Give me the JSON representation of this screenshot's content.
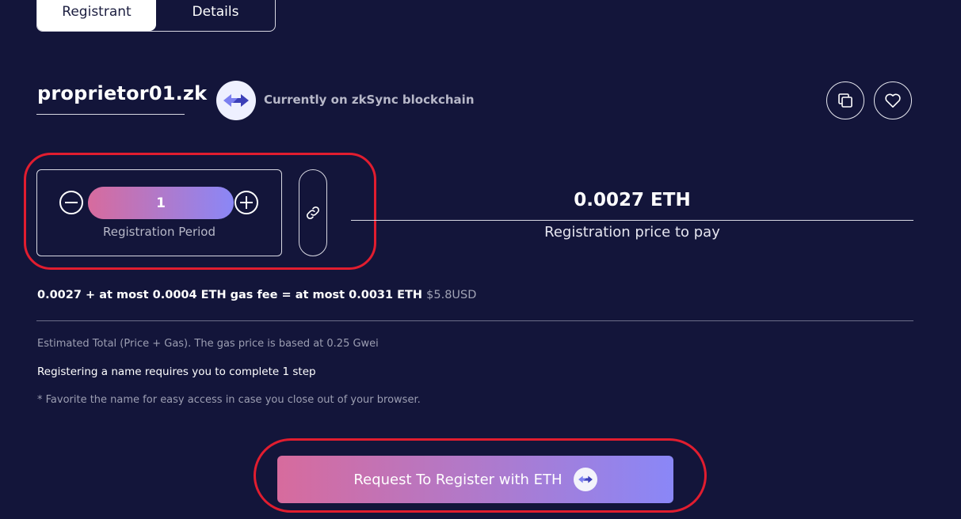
{
  "tabs": [
    {
      "label": "Registrant",
      "active": true
    },
    {
      "label": "Details",
      "active": false
    }
  ],
  "domain": {
    "name": "proprietor01.zk",
    "chain_text": "Currently on zkSync blockchain",
    "chain_icon": "zksync-arrows-icon"
  },
  "actions": {
    "copy_icon": "copy-icon",
    "favorite_icon": "heart-icon"
  },
  "period": {
    "value": "1",
    "label": "Registration Period",
    "minus_icon": "minus-circle-icon",
    "plus_icon": "plus-circle-icon",
    "link_icon": "link-icon"
  },
  "price": {
    "amount": "0.0027 ETH",
    "label": "Registration price to pay"
  },
  "fee": {
    "text": "0.0027 + at most 0.0004 ETH gas fee = at most 0.0031 ETH",
    "usd": "$5.8USD"
  },
  "notes": {
    "estimate": "Estimated Total (Price + Gas). The gas price is based at 0.25 Gwei",
    "steps": "Registering a name requires you to complete 1 step",
    "favorite": "* Favorite the name for easy access in case you close out of your browser."
  },
  "register_button": {
    "label": "Request To Register with ETH",
    "icon": "zksync-arrows-icon"
  },
  "colors": {
    "background": "#13153a",
    "gradient_start": "#d76b9d",
    "gradient_end": "#8a87f7",
    "highlight": "#e11d2f"
  }
}
